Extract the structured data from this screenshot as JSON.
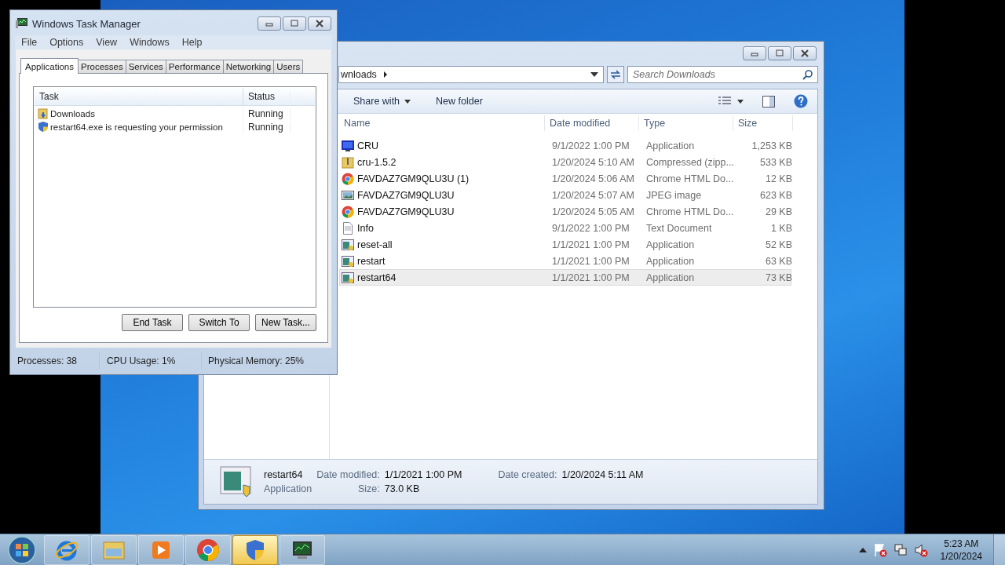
{
  "explorer": {
    "address": "wnloads",
    "search": {
      "placeholder": "Search Downloads"
    },
    "toolbar": [
      "Share with",
      "New folder"
    ],
    "columns": [
      "Name",
      "Date modified",
      "Type",
      "Size"
    ],
    "files": [
      {
        "name": "CRU",
        "date": "9/1/2022 1:00 PM",
        "type": "Application",
        "size": "1,253 KB",
        "kind": "monitor",
        "selected": false
      },
      {
        "name": "cru-1.5.2",
        "date": "1/20/2024 5:10 AM",
        "type": "Compressed (zipp...",
        "size": "533 KB",
        "kind": "zip",
        "selected": false
      },
      {
        "name": "FAVDAZ7GM9QLU3U (1)",
        "date": "1/20/2024 5:06 AM",
        "type": "Chrome HTML Do...",
        "size": "12 KB",
        "kind": "chrome",
        "selected": false
      },
      {
        "name": "FAVDAZ7GM9QLU3U",
        "date": "1/20/2024 5:07 AM",
        "type": "JPEG image",
        "size": "623 KB",
        "kind": "image",
        "selected": false
      },
      {
        "name": "FAVDAZ7GM9QLU3U",
        "date": "1/20/2024 5:05 AM",
        "type": "Chrome HTML Do...",
        "size": "29 KB",
        "kind": "chrome",
        "selected": false
      },
      {
        "name": "Info",
        "date": "9/1/2022 1:00 PM",
        "type": "Text Document",
        "size": "1 KB",
        "kind": "text",
        "selected": false
      },
      {
        "name": "reset-all",
        "date": "1/1/2021 1:00 PM",
        "type": "Application",
        "size": "52 KB",
        "kind": "app",
        "selected": false
      },
      {
        "name": "restart",
        "date": "1/1/2021 1:00 PM",
        "type": "Application",
        "size": "63 KB",
        "kind": "app",
        "selected": false
      },
      {
        "name": "restart64",
        "date": "1/1/2021 1:00 PM",
        "type": "Application",
        "size": "73 KB",
        "kind": "app",
        "selected": true
      }
    ],
    "details": {
      "name": "restart64",
      "type": "Application",
      "fields": [
        {
          "label": "Date modified:",
          "value": "1/1/2021 1:00 PM"
        },
        {
          "label": "Date created:",
          "value": "1/20/2024 5:11 AM"
        },
        {
          "label": "Size:",
          "value": "73.0 KB"
        }
      ]
    }
  },
  "task_manager": {
    "title": "Windows Task Manager",
    "menu": [
      "File",
      "Options",
      "View",
      "Windows",
      "Help"
    ],
    "tabs": [
      {
        "label": "Applications",
        "selected": true
      },
      {
        "label": "Processes",
        "selected": false
      },
      {
        "label": "Services",
        "selected": false
      },
      {
        "label": "Performance",
        "selected": false
      },
      {
        "label": "Networking",
        "selected": false
      },
      {
        "label": "Users",
        "selected": false
      }
    ],
    "columns": [
      "Task",
      "Status"
    ],
    "rows": [
      {
        "task": "Downloads",
        "status": "Running",
        "kind": "folder"
      },
      {
        "task": "restart64.exe is requesting your permission",
        "status": "Running",
        "kind": "shield"
      }
    ],
    "buttons": [
      "End Task",
      "Switch To",
      "New Task..."
    ],
    "status_bar": [
      "Processes: 38",
      "CPU Usage: 1%",
      "Physical Memory: 25%"
    ]
  },
  "taskbar": {
    "items": [
      {
        "kind": "ie",
        "selected": false
      },
      {
        "kind": "folder",
        "selected": false
      },
      {
        "kind": "media",
        "selected": false
      },
      {
        "kind": "chrome",
        "selected": false
      },
      {
        "kind": "shield",
        "selected": true
      },
      {
        "kind": "monitor",
        "selected": false
      }
    ],
    "time": "5:23 AM",
    "date": "1/20/2024"
  }
}
